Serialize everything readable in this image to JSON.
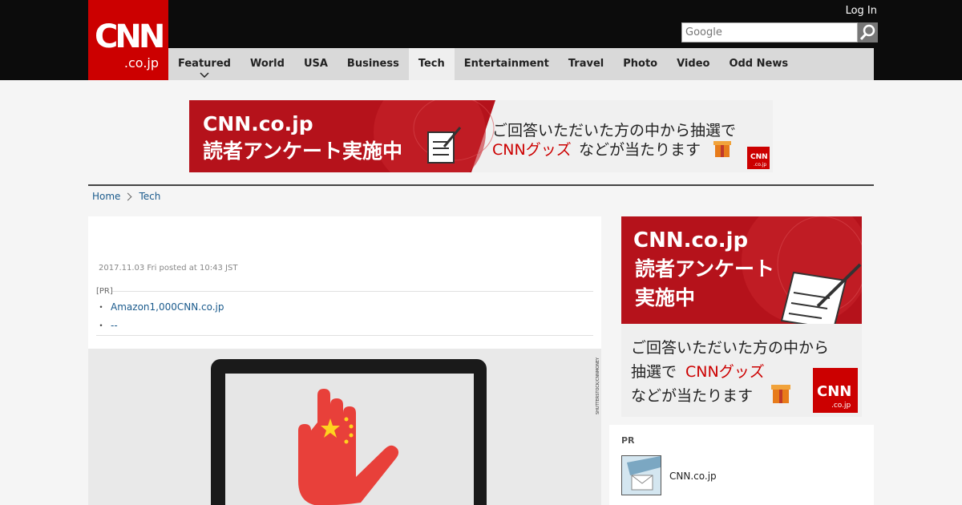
{
  "header": {
    "logo_main": "CNN",
    "logo_sub": ".co.jp",
    "login_label": "Log In",
    "search_placeholder": "Google"
  },
  "nav": {
    "items": [
      {
        "label": "Featured",
        "has_dropdown": true
      },
      {
        "label": "World"
      },
      {
        "label": "USA"
      },
      {
        "label": "Business"
      },
      {
        "label": "Tech",
        "active": true
      },
      {
        "label": "Entertainment"
      },
      {
        "label": "Travel"
      },
      {
        "label": "Photo"
      },
      {
        "label": "Video"
      },
      {
        "label": "Odd News"
      }
    ]
  },
  "banner_top": {
    "line1": "CNN.co.jp",
    "line2": "読者アンケート実施中",
    "line3": "ご回答いただいた方の中から抽選で",
    "line4_highlight": "CNNグッズ",
    "line4_rest": "などが当たります",
    "badge": "CNN",
    "badge_sub": ".co.jp"
  },
  "breadcrumb": {
    "home": "Home",
    "current": "Tech"
  },
  "article": {
    "date": "2017.11.03 Fri posted at 10:43 JST",
    "pr_label": "[PR]",
    "pr_links": [
      {
        "bullet": "・",
        "text": "Amazon1,000CNN.co.jp"
      },
      {
        "bullet": "・",
        "text": "--"
      }
    ],
    "image_credit": "SHUTTERSTOCK/CNNMONEY"
  },
  "side_banner": {
    "line1": "CNN.co.jp",
    "line2": "読者アンケート",
    "line3": "実施中",
    "line4": "ご回答いただいた方の中から",
    "line5a": "抽選で",
    "line5_highlight": "CNNグッズ",
    "line6": "などが当たります",
    "badge": "CNN",
    "badge_sub": ".co.jp"
  },
  "pr_box": {
    "title": "PR",
    "item_text": "CNN.co.jp"
  },
  "colors": {
    "brand_red": "#cc0000",
    "top_bar": "#0c0c0c",
    "nav_bg": "#d9d9d9",
    "link_blue": "#1a5a8c"
  }
}
